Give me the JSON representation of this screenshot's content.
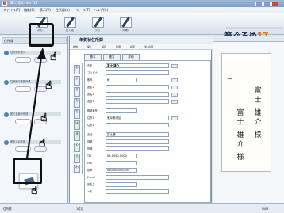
{
  "window": {
    "title": "筆ぐるめ Ver. 17"
  },
  "menus": [
    "ファイル(F)",
    "編集(E)",
    "表示(V)",
    "住所録(A)",
    "ツール(T)",
    "ヘルプ(H)"
  ],
  "toolbar": [
    {
      "label": "おもて"
    },
    {
      "label": "宛て名"
    },
    {
      "label": "うら"
    },
    {
      "label": "印刷"
    }
  ],
  "logo": {
    "text": "筆ぐるめ",
    "version": "17"
  },
  "left_panel": {
    "header": "住所録",
    "items": [
      "住所録を開く",
      "住所録の新規作成",
      "宛て名面の作成",
      "差出人の作成"
    ]
  },
  "main": {
    "title": "年賀状住所録",
    "toolbar": [
      "新規",
      "開く",
      "保存",
      "印刷",
      "検索",
      "並べ替え"
    ],
    "form_tabs": [
      "基本",
      "連名",
      "詳細"
    ],
    "vertical_tabs": [
      "あ",
      "か",
      "さ",
      "た",
      "な",
      "は",
      "ま",
      "や",
      "ら",
      "わ"
    ],
    "fields": [
      {
        "label": "氏名",
        "value": "富士 雄介"
      },
      {
        "label": "フリガナ",
        "value": ""
      },
      {
        "label": "敬称",
        "value": "様"
      },
      {
        "label": "連名1",
        "value": ""
      },
      {
        "label": "連名2",
        "value": ""
      },
      {
        "label": "連名3",
        "value": ""
      },
      {
        "label": "郵便番号",
        "value": ""
      },
      {
        "label": "住所1",
        "value": "東京都港区"
      },
      {
        "label": "住所2",
        "value": ""
      },
      {
        "label": "会社",
        "value": "富士通"
      },
      {
        "label": "部署",
        "value": ""
      },
      {
        "label": "役職",
        "value": ""
      },
      {
        "label": "TEL",
        "value": "03-0000-0000"
      },
      {
        "label": "FAX",
        "value": ""
      },
      {
        "label": "携帯",
        "value": "090-0000-0000"
      },
      {
        "label": "E-mail",
        "value": ""
      },
      {
        "label": "誕生日",
        "value": ""
      },
      {
        "label": "メモ",
        "value": ""
      }
    ]
  },
  "preview": {
    "recipient_chars": [
      "富",
      "士",
      "雄",
      "介",
      "様"
    ],
    "right_chars": [
      "富",
      "士",
      "雄",
      "介",
      "様"
    ]
  },
  "status": {
    "items": [
      "住所録",
      "1件目",
      "NUM"
    ]
  }
}
